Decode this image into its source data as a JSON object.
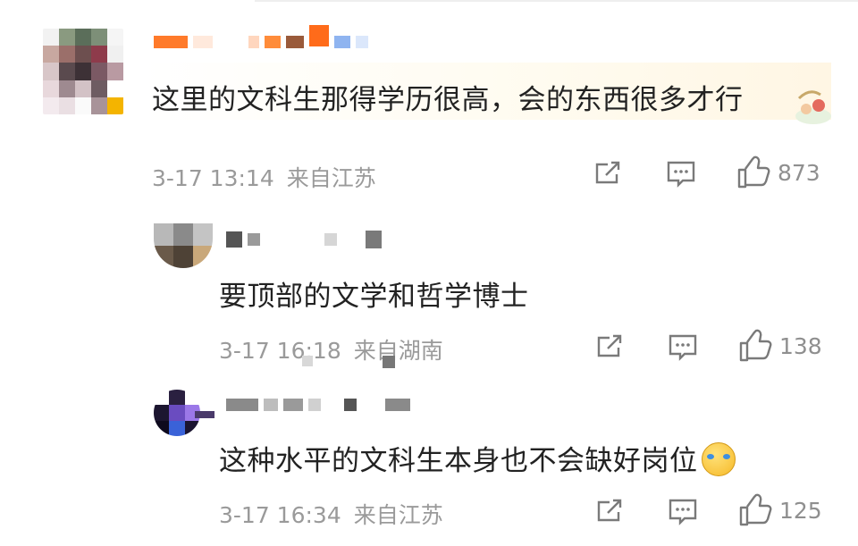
{
  "comments": [
    {
      "text": "这里的文科生那得学历很高，会的东西很多才行",
      "time": "3-17 13:14",
      "location": "来自江苏",
      "likes": "873"
    },
    {
      "text": "要顶部的文学和哲学博士",
      "time": "3-17 16:18",
      "location": "来自湖南",
      "likes": "138"
    },
    {
      "text": "这种水平的文科生本身也不会缺好岗位",
      "time": "3-17 16:34",
      "location": "来自江苏",
      "likes": "125"
    }
  ],
  "icons": {
    "share": "share-icon",
    "reply": "comment-icon",
    "like": "thumbs-up-icon",
    "emoji": "laugh-cry-emoji-icon"
  },
  "colors": {
    "text": "#222222",
    "meta": "#9a9a9a",
    "icon": "#7a7a7a"
  }
}
